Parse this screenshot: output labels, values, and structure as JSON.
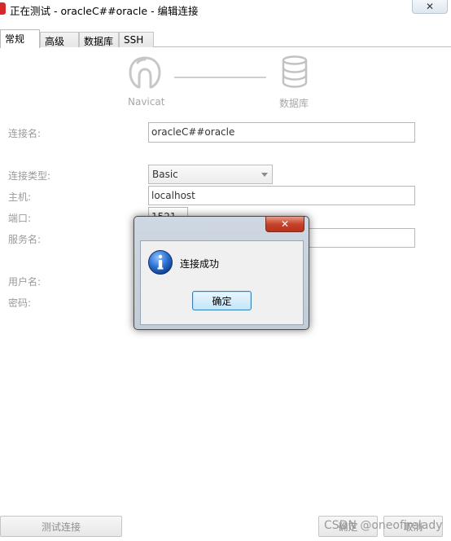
{
  "window": {
    "title": "正在测试 - oracleC##oracle - 编辑连接",
    "close_label": "✕"
  },
  "tabs": [
    {
      "label": "常规",
      "active": true
    },
    {
      "label": "高级",
      "active": false
    },
    {
      "label": "数据库",
      "active": false
    },
    {
      "label": "SSH",
      "active": false
    }
  ],
  "header": {
    "left_label": "Navicat",
    "right_label": "数据库"
  },
  "form": {
    "conn_name_label": "连接名:",
    "conn_name_value": "oracleC##oracle",
    "conn_type_label": "连接类型:",
    "conn_type_value": "Basic",
    "host_label": "主机:",
    "host_value": "localhost",
    "port_label": "端口:",
    "port_value": "1521",
    "service_label": "服务名:",
    "service_value": "",
    "user_label": "用户名:",
    "password_label": "密码:"
  },
  "buttons": {
    "test_label": "测试连接",
    "ok_label": "确定",
    "cancel_label": "取消"
  },
  "watermark": "CSDN @oneofirelady",
  "dialog": {
    "close_label": "✕",
    "message": "连接成功",
    "ok_label": "确定"
  },
  "colors": {
    "navicat_logo": "#c7c7c7",
    "title_icon": "#d42a2a",
    "dialog_close": "#c6432b",
    "info_icon": "#1f5fb8"
  }
}
